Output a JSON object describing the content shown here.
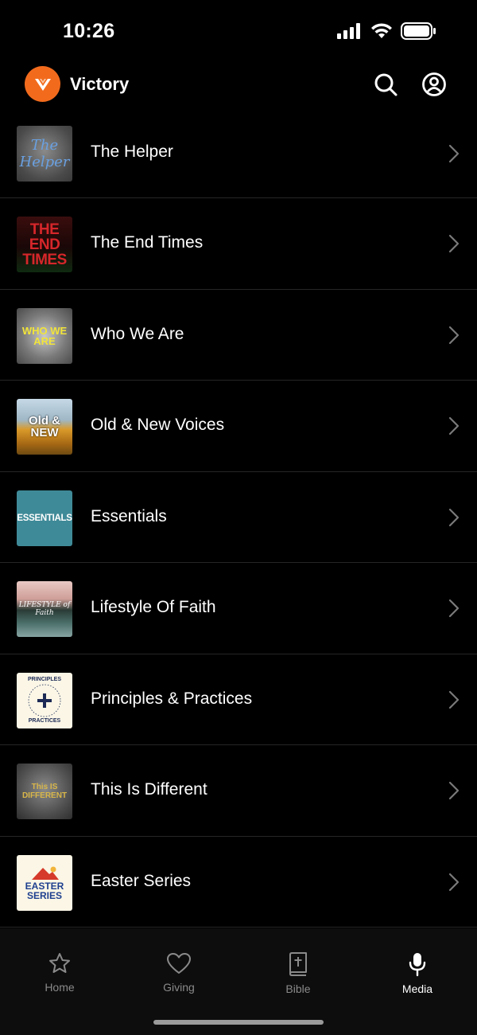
{
  "status_bar": {
    "time": "10:26"
  },
  "header": {
    "app_name": "Victory"
  },
  "series": [
    {
      "title": "The Helper",
      "thumb_text": "The Helper"
    },
    {
      "title": "The End Times",
      "thumb_text": "THE END TIMES"
    },
    {
      "title": "Who We Are",
      "thumb_text": "WHO WE ARE"
    },
    {
      "title": "Old & New Voices",
      "thumb_text": "Old & NEW"
    },
    {
      "title": "Essentials",
      "thumb_text": "ESSENTIALS"
    },
    {
      "title": "Lifestyle Of Faith",
      "thumb_text": "LIFESTYLE of Faith"
    },
    {
      "title": "Principles & Practices",
      "thumb_text": "PRINCIPLES PRACTICES"
    },
    {
      "title": "This Is Different",
      "thumb_text": "This IS DIFFERENT"
    },
    {
      "title": "Easter Series",
      "thumb_text": "EASTER SERIES"
    }
  ],
  "tabs": [
    {
      "label": "Home",
      "icon": "star-icon"
    },
    {
      "label": "Giving",
      "icon": "heart-icon"
    },
    {
      "label": "Bible",
      "icon": "bible-icon"
    },
    {
      "label": "Media",
      "icon": "microphone-icon"
    }
  ],
  "colors": {
    "accent": "#f26b1d",
    "background": "#000000",
    "tab_bar": "#0d0d0d",
    "active_tab": "#ffffff",
    "inactive_tab": "#8a8a8a"
  }
}
